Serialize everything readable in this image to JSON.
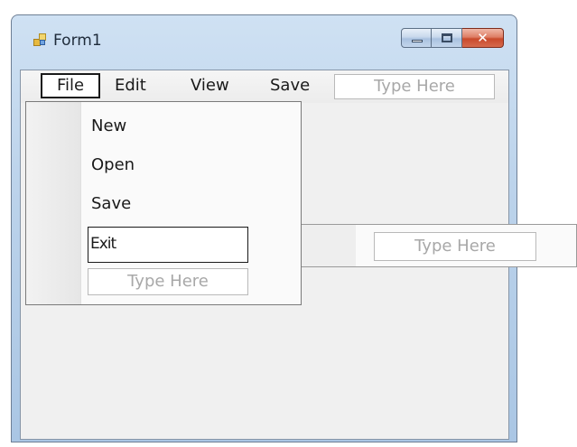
{
  "window": {
    "title": "Form1",
    "icon": "form-icon"
  },
  "caption_buttons": {
    "minimize": "minimize-icon",
    "maximize": "maximize-icon",
    "close": "close-icon",
    "close_glyph": "✕"
  },
  "menubar": {
    "items": [
      "File",
      "Edit",
      "View",
      "Save"
    ],
    "type_here": "Type Here"
  },
  "file_menu": {
    "items": [
      "New",
      "Open",
      "Save",
      "Exit"
    ],
    "type_here": "Type Here"
  },
  "submenu": {
    "type_here": "Type Here"
  },
  "colors": {
    "close_button": "#c94a2c",
    "client_bg": "#f0f0f0",
    "placeholder_text": "#a8a8a8"
  }
}
